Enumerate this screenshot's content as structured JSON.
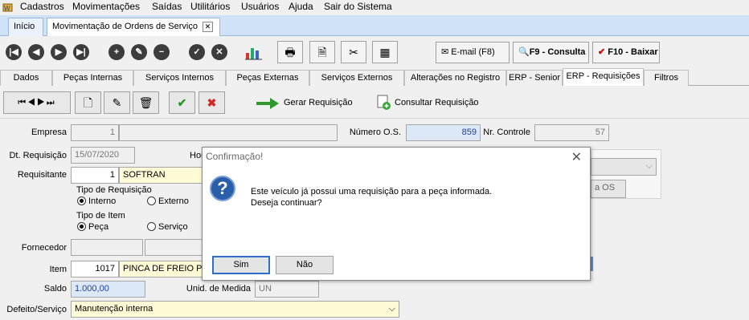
{
  "menu": [
    "Cadastros",
    "Movimentações",
    "Saídas",
    "Utilitários",
    "Usuários",
    "Ajuda",
    "Sair do Sistema"
  ],
  "doc_tabs": [
    "Início",
    "Movimentação de Ordens de Serviço"
  ],
  "toolbar": {
    "email": "E-mail (F8)",
    "consulta": "F9 - Consulta",
    "baixar": "F10 - Baixar"
  },
  "form_tabs": [
    "Dados",
    "Peças Internas",
    "Serviços Internos",
    "Peças Externas",
    "Serviços Externos",
    "Alterações no Registro",
    "ERP - Senior",
    "ERP - Requisições",
    "Filtros"
  ],
  "sub_toolbar": {
    "gerar": "Gerar Requisição",
    "consultar": "Consultar Requisição"
  },
  "form": {
    "empresa_label": "Empresa",
    "empresa_code": "1",
    "numero_os_label": "Número O.S.",
    "numero_os": "859",
    "nr_controle_label": "Nr. Controle",
    "nr_controle": "57",
    "dt_requisicao_label": "Dt. Requisição",
    "dt_requisicao": "15/07/2020",
    "hora_label": "Hor",
    "requisitante_label": "Requisitante",
    "requisitante_code": "1",
    "requisitante_name": "SOFTRAN",
    "tipo_requisicao_label": "Tipo de Requisição",
    "tipo_req_interno": "Interno",
    "tipo_req_externo": "Externo",
    "tipo_item_label": "Tipo de Item",
    "tipo_item_peca": "Peça",
    "tipo_item_servico": "Serviço",
    "fornecedor_label": "Fornecedor",
    "item_label": "Item",
    "item_code": "1017",
    "item_name": "PINCA DE FREIO PEC",
    "saldo_label": "Saldo",
    "saldo": "1.000,00",
    "unid_medida_label": "Unid. de Medida",
    "unid_medida": "UN",
    "defeito_label": "Defeito/Serviço",
    "defeito": "Manutenção interna",
    "os_button_partial": "a OS"
  },
  "dialog": {
    "title": "Confirmação!",
    "line1": "Este veículo já possui uma requisição para a peça informada.",
    "line2": "Deseja continuar?",
    "yes": "Sim",
    "no": "Não"
  }
}
